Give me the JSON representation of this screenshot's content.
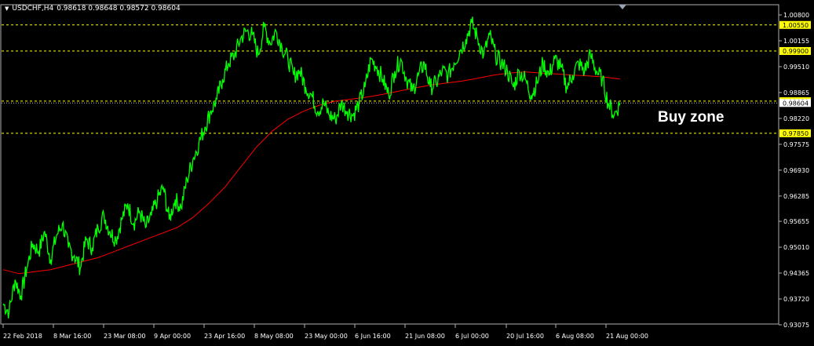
{
  "header": {
    "symbol_timeframe": "USDCHF,H4",
    "ohlc": "0.98618 0.98648 0.98572 0.98604"
  },
  "annotation": {
    "text": "Buy zone"
  },
  "chart_data": {
    "type": "line",
    "title": "USDCHF,H4",
    "ylim": [
      0.93075,
      1.008
    ],
    "price_ticks": [
      "1.00800",
      "1.00155",
      "0.99510",
      "0.98865",
      "0.98220",
      "0.97575",
      "0.96930",
      "0.96285",
      "0.95655",
      "0.95010",
      "0.94365",
      "0.93720",
      "0.93075"
    ],
    "time_ticks": [
      "22 Feb 2018",
      "8 Mar 16:00",
      "23 Mar 08:00",
      "9 Apr 00:00",
      "23 Apr 16:00",
      "8 May 08:00",
      "23 May 00:00",
      "6 Jun 16:00",
      "21 Jun 08:00",
      "6 Jul 00:00",
      "20 Jul 16:00",
      "6 Aug 08:00",
      "21 Aug 00:00"
    ],
    "horizontal_levels": [
      {
        "value": 1.0055,
        "label": "1.00550",
        "color": "#ffff00",
        "style": "dashed"
      },
      {
        "value": 0.999,
        "label": "0.99900",
        "color": "#ffff00",
        "style": "dashed"
      },
      {
        "value": 0.9865,
        "label": "0.98650",
        "color": "#ffff00",
        "style": "dashed"
      },
      {
        "value": 0.9785,
        "label": "0.97850",
        "color": "#ffff00",
        "style": "dashed"
      },
      {
        "value": 0.98604,
        "label": "0.98604",
        "color": "#c0c0c0",
        "style": "dotted"
      }
    ],
    "series": [
      {
        "color": "#00ff00",
        "values": [
          0.936,
          0.934,
          0.942,
          0.938,
          0.945,
          0.951,
          0.949,
          0.954,
          0.947,
          0.953,
          0.956,
          0.95,
          0.948,
          0.945,
          0.952,
          0.95,
          0.955,
          0.958,
          0.954,
          0.952,
          0.957,
          0.961,
          0.956,
          0.959,
          0.955,
          0.958,
          0.962,
          0.965,
          0.957,
          0.962,
          0.96,
          0.967,
          0.972,
          0.976,
          0.98,
          0.984,
          0.987,
          0.992,
          0.996,
          0.998,
          1.002,
          1.004,
          1.003,
          0.998,
          1.005,
          1.001,
          1.004,
          1.0,
          0.997,
          0.993,
          0.994,
          0.99,
          0.988,
          0.984,
          0.986,
          0.983,
          0.982,
          0.986,
          0.984,
          0.983,
          0.986,
          0.99,
          0.997,
          0.995,
          0.992,
          0.988,
          0.994,
          0.997,
          0.992,
          0.989,
          0.993,
          0.996,
          0.99,
          0.991,
          0.994,
          0.993,
          0.996,
          0.999,
          1.002,
          1.006,
          1.002,
          0.998,
          1.003,
          0.998,
          0.996,
          0.994,
          0.99,
          0.994,
          0.992,
          0.988,
          0.991,
          0.996,
          0.993,
          0.997,
          0.995,
          0.99,
          0.993,
          0.996,
          0.994,
          0.998,
          0.994,
          0.992,
          0.986,
          0.983,
          0.986
        ]
      },
      {
        "color": "#ff0000",
        "values": [
          0.9445,
          0.9435,
          0.944,
          0.9445,
          0.9455,
          0.9465,
          0.9475,
          0.949,
          0.9505,
          0.952,
          0.9535,
          0.955,
          0.9575,
          0.961,
          0.965,
          0.97,
          0.975,
          0.979,
          0.982,
          0.984,
          0.9855,
          0.9865,
          0.987,
          0.9875,
          0.9882,
          0.989,
          0.9898,
          0.9905,
          0.991,
          0.9915,
          0.9922,
          0.993,
          0.9935,
          0.9938,
          0.9935,
          0.9933,
          0.993,
          0.9928,
          0.9925,
          0.992
        ]
      }
    ]
  }
}
